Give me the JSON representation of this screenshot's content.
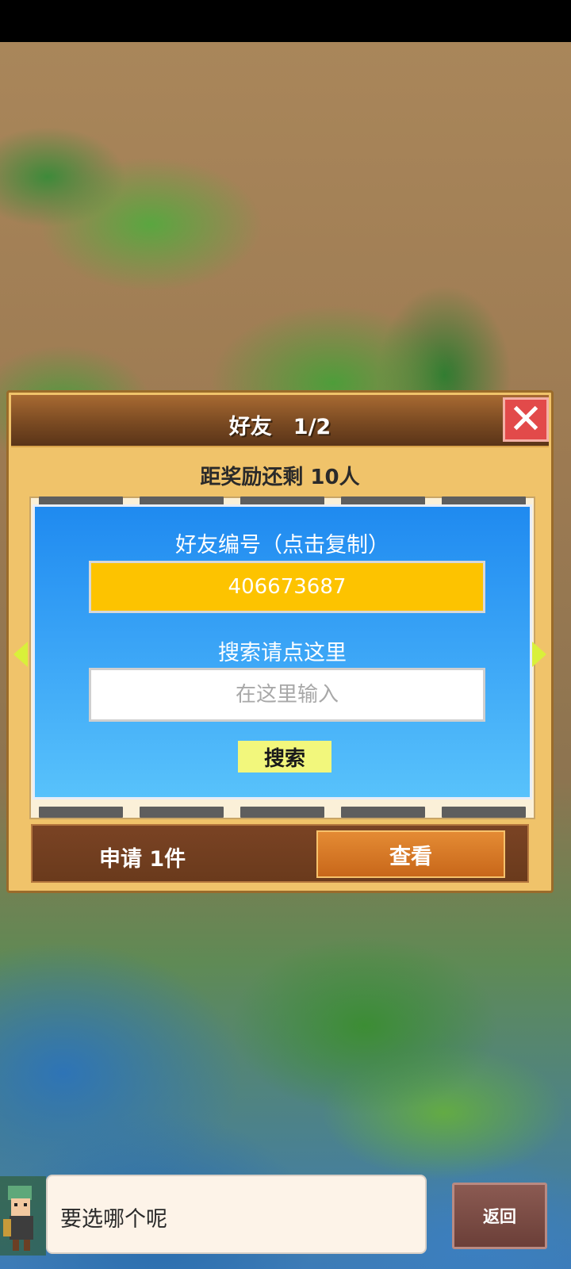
{
  "panel": {
    "title": "好友　1/2",
    "reward_text": "距奖励还剩 10人"
  },
  "search_dialog": {
    "friend_id_label": "好友编号（点击复制）",
    "friend_id": "406673687",
    "search_hint": "搜索请点这里",
    "input_placeholder": "在这里输入",
    "search_button": "搜索"
  },
  "requests": {
    "label": "申请 1件",
    "view_button": "查看"
  },
  "footer": {
    "speech": "要选哪个呢",
    "back_button": "返回"
  },
  "icons": {
    "close": "close-icon",
    "prev": "arrow-left-icon",
    "next": "arrow-right-icon"
  },
  "colors": {
    "accent_yellow": "#fdc300",
    "dialog_blue": "#1f8af0",
    "close_red": "#e24a4a",
    "view_orange": "#e48b34"
  }
}
